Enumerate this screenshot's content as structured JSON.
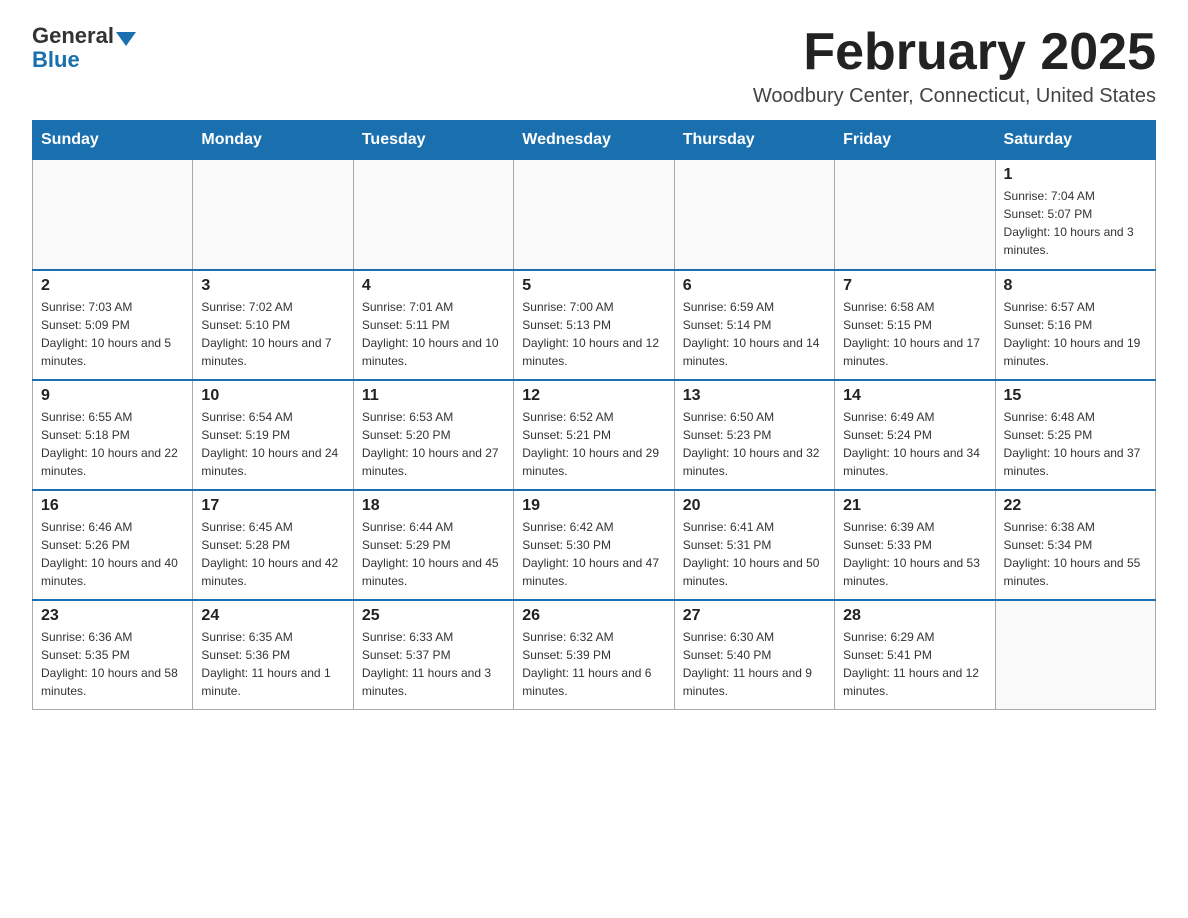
{
  "logo": {
    "general": "General",
    "blue": "Blue"
  },
  "header": {
    "month": "February 2025",
    "location": "Woodbury Center, Connecticut, United States"
  },
  "weekdays": [
    "Sunday",
    "Monday",
    "Tuesday",
    "Wednesday",
    "Thursday",
    "Friday",
    "Saturday"
  ],
  "weeks": [
    [
      {
        "day": "",
        "sunrise": "",
        "sunset": "",
        "daylight": ""
      },
      {
        "day": "",
        "sunrise": "",
        "sunset": "",
        "daylight": ""
      },
      {
        "day": "",
        "sunrise": "",
        "sunset": "",
        "daylight": ""
      },
      {
        "day": "",
        "sunrise": "",
        "sunset": "",
        "daylight": ""
      },
      {
        "day": "",
        "sunrise": "",
        "sunset": "",
        "daylight": ""
      },
      {
        "day": "",
        "sunrise": "",
        "sunset": "",
        "daylight": ""
      },
      {
        "day": "1",
        "sunrise": "Sunrise: 7:04 AM",
        "sunset": "Sunset: 5:07 PM",
        "daylight": "Daylight: 10 hours and 3 minutes."
      }
    ],
    [
      {
        "day": "2",
        "sunrise": "Sunrise: 7:03 AM",
        "sunset": "Sunset: 5:09 PM",
        "daylight": "Daylight: 10 hours and 5 minutes."
      },
      {
        "day": "3",
        "sunrise": "Sunrise: 7:02 AM",
        "sunset": "Sunset: 5:10 PM",
        "daylight": "Daylight: 10 hours and 7 minutes."
      },
      {
        "day": "4",
        "sunrise": "Sunrise: 7:01 AM",
        "sunset": "Sunset: 5:11 PM",
        "daylight": "Daylight: 10 hours and 10 minutes."
      },
      {
        "day": "5",
        "sunrise": "Sunrise: 7:00 AM",
        "sunset": "Sunset: 5:13 PM",
        "daylight": "Daylight: 10 hours and 12 minutes."
      },
      {
        "day": "6",
        "sunrise": "Sunrise: 6:59 AM",
        "sunset": "Sunset: 5:14 PM",
        "daylight": "Daylight: 10 hours and 14 minutes."
      },
      {
        "day": "7",
        "sunrise": "Sunrise: 6:58 AM",
        "sunset": "Sunset: 5:15 PM",
        "daylight": "Daylight: 10 hours and 17 minutes."
      },
      {
        "day": "8",
        "sunrise": "Sunrise: 6:57 AM",
        "sunset": "Sunset: 5:16 PM",
        "daylight": "Daylight: 10 hours and 19 minutes."
      }
    ],
    [
      {
        "day": "9",
        "sunrise": "Sunrise: 6:55 AM",
        "sunset": "Sunset: 5:18 PM",
        "daylight": "Daylight: 10 hours and 22 minutes."
      },
      {
        "day": "10",
        "sunrise": "Sunrise: 6:54 AM",
        "sunset": "Sunset: 5:19 PM",
        "daylight": "Daylight: 10 hours and 24 minutes."
      },
      {
        "day": "11",
        "sunrise": "Sunrise: 6:53 AM",
        "sunset": "Sunset: 5:20 PM",
        "daylight": "Daylight: 10 hours and 27 minutes."
      },
      {
        "day": "12",
        "sunrise": "Sunrise: 6:52 AM",
        "sunset": "Sunset: 5:21 PM",
        "daylight": "Daylight: 10 hours and 29 minutes."
      },
      {
        "day": "13",
        "sunrise": "Sunrise: 6:50 AM",
        "sunset": "Sunset: 5:23 PM",
        "daylight": "Daylight: 10 hours and 32 minutes."
      },
      {
        "day": "14",
        "sunrise": "Sunrise: 6:49 AM",
        "sunset": "Sunset: 5:24 PM",
        "daylight": "Daylight: 10 hours and 34 minutes."
      },
      {
        "day": "15",
        "sunrise": "Sunrise: 6:48 AM",
        "sunset": "Sunset: 5:25 PM",
        "daylight": "Daylight: 10 hours and 37 minutes."
      }
    ],
    [
      {
        "day": "16",
        "sunrise": "Sunrise: 6:46 AM",
        "sunset": "Sunset: 5:26 PM",
        "daylight": "Daylight: 10 hours and 40 minutes."
      },
      {
        "day": "17",
        "sunrise": "Sunrise: 6:45 AM",
        "sunset": "Sunset: 5:28 PM",
        "daylight": "Daylight: 10 hours and 42 minutes."
      },
      {
        "day": "18",
        "sunrise": "Sunrise: 6:44 AM",
        "sunset": "Sunset: 5:29 PM",
        "daylight": "Daylight: 10 hours and 45 minutes."
      },
      {
        "day": "19",
        "sunrise": "Sunrise: 6:42 AM",
        "sunset": "Sunset: 5:30 PM",
        "daylight": "Daylight: 10 hours and 47 minutes."
      },
      {
        "day": "20",
        "sunrise": "Sunrise: 6:41 AM",
        "sunset": "Sunset: 5:31 PM",
        "daylight": "Daylight: 10 hours and 50 minutes."
      },
      {
        "day": "21",
        "sunrise": "Sunrise: 6:39 AM",
        "sunset": "Sunset: 5:33 PM",
        "daylight": "Daylight: 10 hours and 53 minutes."
      },
      {
        "day": "22",
        "sunrise": "Sunrise: 6:38 AM",
        "sunset": "Sunset: 5:34 PM",
        "daylight": "Daylight: 10 hours and 55 minutes."
      }
    ],
    [
      {
        "day": "23",
        "sunrise": "Sunrise: 6:36 AM",
        "sunset": "Sunset: 5:35 PM",
        "daylight": "Daylight: 10 hours and 58 minutes."
      },
      {
        "day": "24",
        "sunrise": "Sunrise: 6:35 AM",
        "sunset": "Sunset: 5:36 PM",
        "daylight": "Daylight: 11 hours and 1 minute."
      },
      {
        "day": "25",
        "sunrise": "Sunrise: 6:33 AM",
        "sunset": "Sunset: 5:37 PM",
        "daylight": "Daylight: 11 hours and 3 minutes."
      },
      {
        "day": "26",
        "sunrise": "Sunrise: 6:32 AM",
        "sunset": "Sunset: 5:39 PM",
        "daylight": "Daylight: 11 hours and 6 minutes."
      },
      {
        "day": "27",
        "sunrise": "Sunrise: 6:30 AM",
        "sunset": "Sunset: 5:40 PM",
        "daylight": "Daylight: 11 hours and 9 minutes."
      },
      {
        "day": "28",
        "sunrise": "Sunrise: 6:29 AM",
        "sunset": "Sunset: 5:41 PM",
        "daylight": "Daylight: 11 hours and 12 minutes."
      },
      {
        "day": "",
        "sunrise": "",
        "sunset": "",
        "daylight": ""
      }
    ]
  ]
}
